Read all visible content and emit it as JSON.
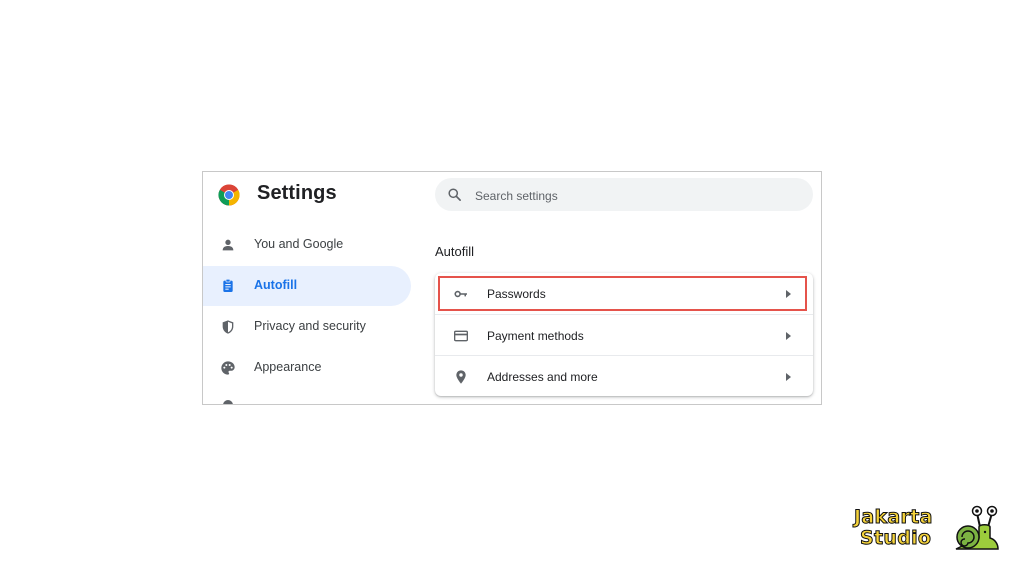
{
  "header": {
    "title": "Settings",
    "logo_icon": "chrome-logo-icon"
  },
  "search": {
    "placeholder": "Search settings",
    "icon": "search-icon"
  },
  "sidebar": {
    "items": [
      {
        "label": "You and Google",
        "icon": "person-icon",
        "active": false
      },
      {
        "label": "Autofill",
        "icon": "clipboard-icon",
        "active": true
      },
      {
        "label": "Privacy and security",
        "icon": "shield-icon",
        "active": false
      },
      {
        "label": "Appearance",
        "icon": "palette-icon",
        "active": false
      }
    ]
  },
  "main": {
    "section_title": "Autofill",
    "rows": [
      {
        "label": "Passwords",
        "icon": "key-icon",
        "highlighted": true
      },
      {
        "label": "Payment methods",
        "icon": "credit-card-icon",
        "highlighted": false
      },
      {
        "label": "Addresses and more",
        "icon": "location-pin-icon",
        "highlighted": false
      }
    ]
  },
  "watermark": {
    "line1": "Jakarta",
    "line2": "Studio"
  },
  "colors": {
    "accent": "#1a73e8",
    "active_bg": "#e8f0fe",
    "highlight_border": "#e5534b",
    "watermark_text": "#f5d33b"
  }
}
